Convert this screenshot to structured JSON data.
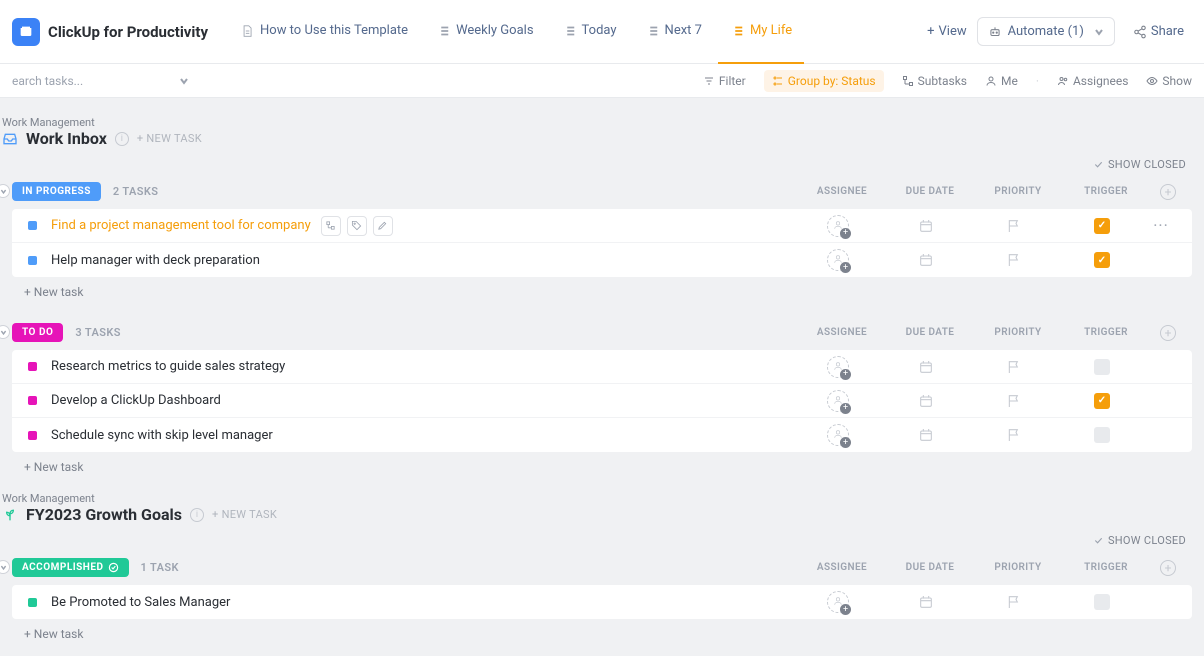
{
  "header": {
    "title": "ClickUp for Productivity",
    "tabs": [
      {
        "label": "How to Use this Template",
        "type": "doc"
      },
      {
        "label": "Weekly Goals",
        "type": "list"
      },
      {
        "label": "Today",
        "type": "list"
      },
      {
        "label": "Next 7",
        "type": "list"
      },
      {
        "label": "My Life",
        "type": "list",
        "active": true
      }
    ],
    "view_btn": "View",
    "automate": "Automate (1)",
    "share": "Share"
  },
  "subheader": {
    "search_placeholder": "earch tasks...",
    "filter": "Filter",
    "group_by": "Group by: Status",
    "subtasks": "Subtasks",
    "me": "Me",
    "assignees": "Assignees",
    "show": "Show"
  },
  "columns": {
    "assignee": "ASSIGNEE",
    "due_date": "DUE DATE",
    "priority": "PRIORITY",
    "trigger": "TRIGGER"
  },
  "sections": [
    {
      "crumb": "Work Management",
      "title": "Work Inbox",
      "icon": "inbox",
      "new_task_label": "+ NEW TASK",
      "show_closed": "SHOW CLOSED",
      "groups": [
        {
          "status": "IN PROGRESS",
          "status_class": "in-progress",
          "count": "2 TASKS",
          "dot_class": "blue",
          "tasks": [
            {
              "name": "Find a project management tool for company",
              "highlight": true,
              "trigger": true,
              "inline_actions": true,
              "more": true
            },
            {
              "name": "Help manager with deck preparation",
              "trigger": true
            }
          ],
          "new_task": "+ New task"
        },
        {
          "status": "TO DO",
          "status_class": "to-do",
          "count": "3 TASKS",
          "dot_class": "pink",
          "tasks": [
            {
              "name": "Research metrics to guide sales strategy",
              "trigger": false
            },
            {
              "name": "Develop a ClickUp Dashboard",
              "trigger": true
            },
            {
              "name": "Schedule sync with skip level manager",
              "trigger": false
            }
          ],
          "new_task": "+ New task"
        }
      ]
    },
    {
      "crumb": "Work Management",
      "title": "FY2023 Growth Goals",
      "icon": "growth",
      "new_task_label": "+ NEW TASK",
      "show_closed": "SHOW CLOSED",
      "groups": [
        {
          "status": "ACCOMPLISHED",
          "status_class": "accomplished",
          "status_check": true,
          "count": "1 TASK",
          "dot_class": "green",
          "tasks": [
            {
              "name": "Be Promoted to Sales Manager",
              "trigger": false
            }
          ],
          "new_task": "+ New task"
        }
      ]
    }
  ]
}
